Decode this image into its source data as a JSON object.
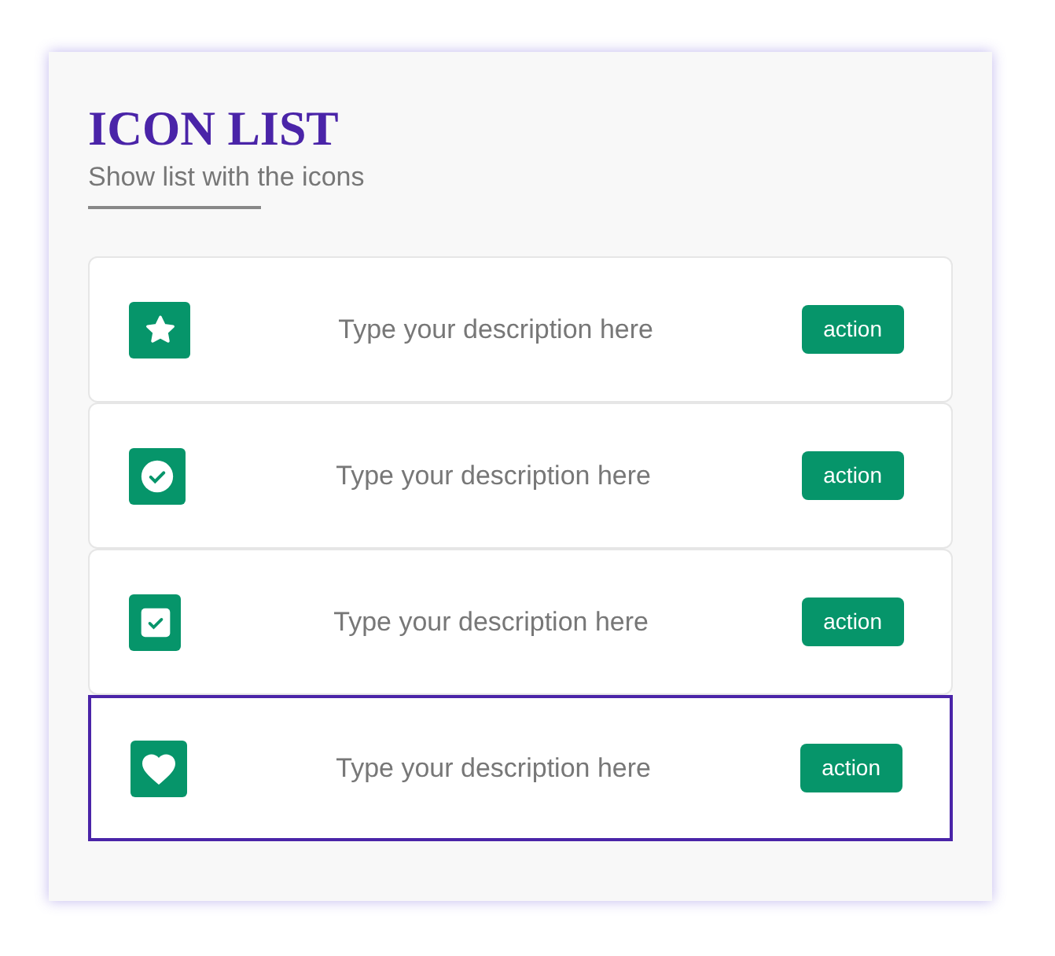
{
  "title": "ICON LIST",
  "subtitle": "Show list with the icons",
  "items": [
    {
      "kind": "star",
      "description": "Type your description here",
      "action": "action",
      "selected": false
    },
    {
      "kind": "check-circle",
      "description": "Type your description here",
      "action": "action",
      "selected": false
    },
    {
      "kind": "check-square",
      "description": "Type your description here",
      "action": "action",
      "selected": false
    },
    {
      "kind": "heart",
      "description": "Type your description here",
      "action": "action",
      "selected": true
    }
  ]
}
